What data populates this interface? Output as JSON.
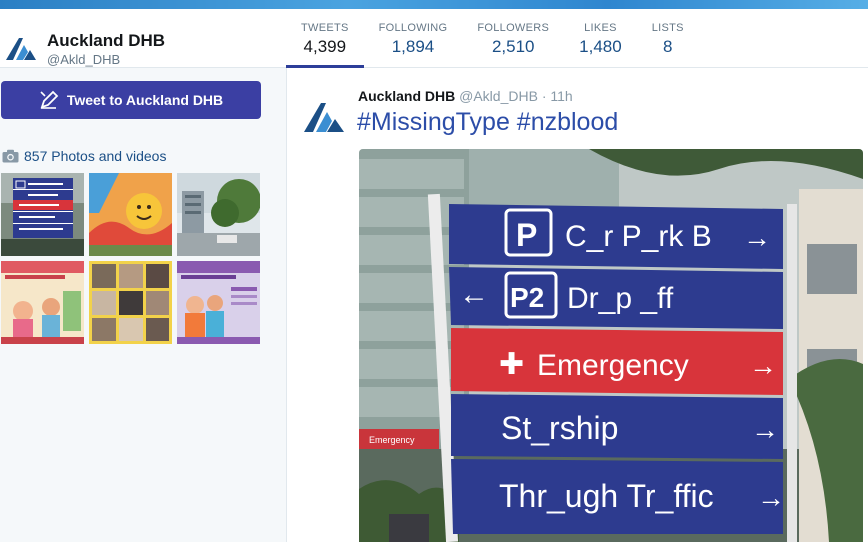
{
  "profile": {
    "name": "Auckland DHB",
    "handle": "@Akld_DHB"
  },
  "stats": [
    {
      "label": "TWEETS",
      "value": "4,399"
    },
    {
      "label": "FOLLOWING",
      "value": "1,894"
    },
    {
      "label": "FOLLOWERS",
      "value": "2,510"
    },
    {
      "label": "LIKES",
      "value": "1,480"
    },
    {
      "label": "LISTS",
      "value": "8"
    }
  ],
  "sidebar": {
    "tweet_button_label": "Tweet to Auckland DHB",
    "photos_label": "857 Photos and videos"
  },
  "tweet": {
    "name": "Auckland DHB",
    "handle": "@Akld_DHB",
    "separator": "·",
    "time": "11h",
    "text": "#MissingType #nzblood",
    "sign": {
      "line1": "C_r P_rk B",
      "line2": "Dr_p _ff",
      "line3": "Emergency",
      "line4": "St_rship",
      "line5": "Thr_ugh Tr_ffic",
      "p_label": "P",
      "p2_label": "P2",
      "arrow_right": "→",
      "arrow_left": "←",
      "plus": "✚"
    },
    "background_sign": "Emergency"
  },
  "colors": {
    "accent": "#3b3fa3",
    "link": "#1b4f86",
    "sign_blue": "#2d3b8f",
    "sign_red": "#d8343b"
  }
}
